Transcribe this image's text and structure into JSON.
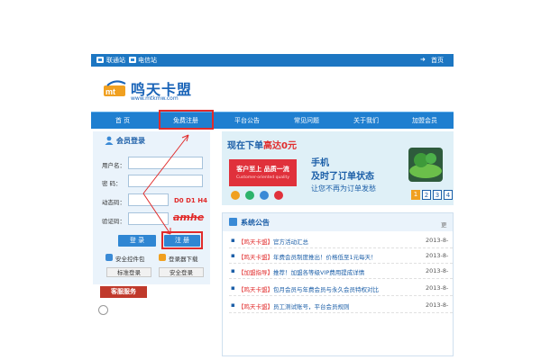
{
  "topbar": {
    "links": [
      "联通站",
      "电信站"
    ],
    "home": "首页"
  },
  "logo": {
    "name": "鸣天卡盟",
    "url": "www.mtkmw.com"
  },
  "nav": {
    "items": [
      "首  页",
      "免费注册",
      "平台公告",
      "常见问题",
      "关于我们",
      "加盟会员"
    ]
  },
  "login": {
    "title": "会员登录",
    "labels": {
      "username": "用户名：",
      "password": "密  码：",
      "dynamic": "动态码：",
      "captcha": "验证码："
    },
    "annotation": "D0 D1 H4",
    "captcha_text": "amhe",
    "login_button": "登 录",
    "register_button": "注 册",
    "security_plugin": "安全控件包",
    "security_browser": "登录器下载",
    "standard_login": "标准登录",
    "secure_login": "安全登录"
  },
  "service": {
    "title": "客服服务"
  },
  "banner": {
    "slogan_prefix": "现在下单",
    "badge": "高达0元",
    "red_box": "客户至上 品质一流",
    "red_box_sub": "Customer-oriented quality",
    "line1": "手机",
    "line2": "及时了订单状态",
    "line3": "让您不再为订单发愁",
    "pages": [
      "1",
      "2",
      "3",
      "4"
    ]
  },
  "news": {
    "title": "系统公告",
    "more": "更",
    "rows": [
      {
        "tag": "【鸣天卡盟】",
        "text": "官方活动汇总",
        "date": "2013-8-"
      },
      {
        "tag": "【鸣天卡盟】",
        "text": "年费会员制度推出！价格低至1元每天！",
        "date": "2013-8-"
      },
      {
        "tag": "【加盟指导】",
        "text": "推荐！加盟各等级VIP费用提成详情",
        "date": "2013-8-"
      },
      {
        "tag": "【鸣天卡盟】",
        "text": "包月会员与年费会员与永久会员特权对比",
        "date": "2013-8-"
      },
      {
        "tag": "【鸣天卡盟】",
        "text": "员工测试账号，平台会员规则",
        "date": "2013-8-"
      }
    ]
  },
  "colors": {
    "brand_blue": "#1f7fd0",
    "annotation_red": "#e12b2b",
    "news_tag_red": "#e12b2b"
  }
}
